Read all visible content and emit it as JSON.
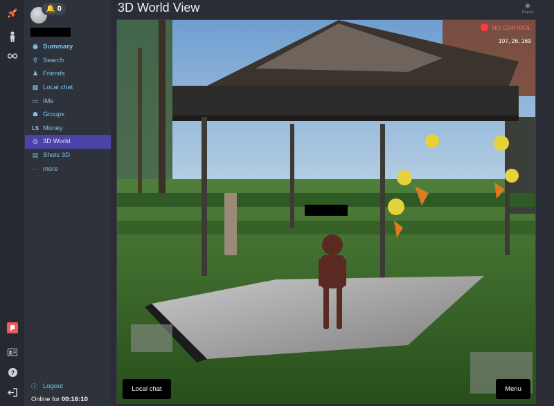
{
  "rail": {
    "icons": [
      "rocket-icon",
      "person-icon",
      "infinity-icon",
      "red-app-icon",
      "id-card-icon",
      "help-icon",
      "exit-icon"
    ]
  },
  "header": {
    "notifications": "0"
  },
  "nav": {
    "items": [
      {
        "label": "Summary",
        "icon": "gauge-icon"
      },
      {
        "label": "Search",
        "icon": "search-icon"
      },
      {
        "label": "Friends",
        "icon": "friends-icon"
      },
      {
        "label": "Local chat",
        "icon": "chat-icon"
      },
      {
        "label": "IMs",
        "icon": "im-icon"
      },
      {
        "label": "Groups",
        "icon": "groups-icon"
      },
      {
        "label": "Money",
        "icon": "money-icon"
      },
      {
        "label": "3D World",
        "icon": "globe-icon"
      },
      {
        "label": "Shots 3D",
        "icon": "shots-icon"
      },
      {
        "label": "more",
        "icon": "more-icon"
      }
    ],
    "logout_label": "Logout",
    "online_label": "Online for",
    "online_time": "00:16:10"
  },
  "main": {
    "title": "3D World View",
    "report_label": "Report",
    "control_status": "NO CONTROL",
    "coordinates": "107, 26, 169",
    "local_chat_button": "Local chat",
    "menu_button": "Menu"
  },
  "colors": {
    "accent_active": "#4a43a8",
    "link": "#7ec3ee",
    "status_red": "#ff3b45"
  }
}
